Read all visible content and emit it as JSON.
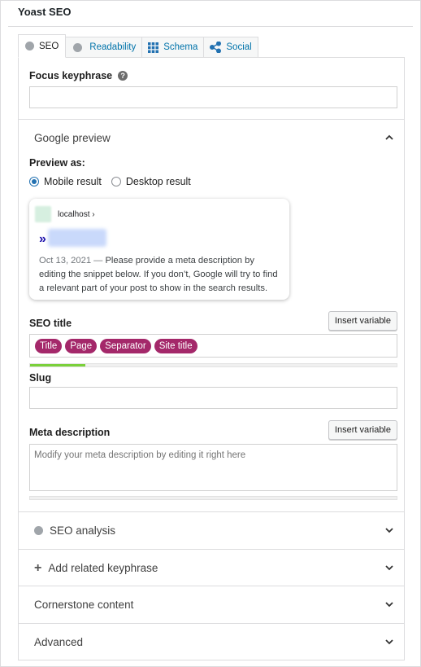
{
  "metabox": {
    "title": "Yoast SEO"
  },
  "tabs": [
    {
      "label": "SEO",
      "icon": "gray-dot-icon"
    },
    {
      "label": "Readability",
      "icon": "gray-dot-icon"
    },
    {
      "label": "Schema",
      "icon": "grid-icon"
    },
    {
      "label": "Social",
      "icon": "share-icon"
    }
  ],
  "focus_keyphrase": {
    "label": "Focus keyphrase",
    "value": "",
    "help_icon": "question-icon"
  },
  "google_preview": {
    "heading": "Google preview",
    "preview_as_label": "Preview as:",
    "options": [
      "Mobile result",
      "Desktop result"
    ],
    "selected": "Mobile result",
    "snippet": {
      "url": "localhost ›",
      "arrow": "»",
      "date": "Oct 13, 2021",
      "dash": "—",
      "description": "Please provide a meta description by editing the snippet below. If you don’t, Google will try to find a relevant part of your post to show in the search results."
    }
  },
  "seo_title": {
    "label": "SEO title",
    "insert_button": "Insert variable",
    "variables": [
      "Title",
      "Page",
      "Separator",
      "Site title"
    ],
    "progress": 0.15,
    "progress_color": "#7ad03a"
  },
  "slug": {
    "label": "Slug",
    "value": ""
  },
  "meta_description": {
    "label": "Meta description",
    "insert_button": "Insert variable",
    "placeholder": "Modify your meta description by editing it right here"
  },
  "sections": {
    "seo_analysis": "SEO analysis",
    "related_keyphrase": "Add related keyphrase",
    "cornerstone": "Cornerstone content",
    "advanced": "Advanced"
  },
  "colors": {
    "accent": "#a4286a",
    "link": "#0073aa",
    "radio": "#2271b1"
  }
}
